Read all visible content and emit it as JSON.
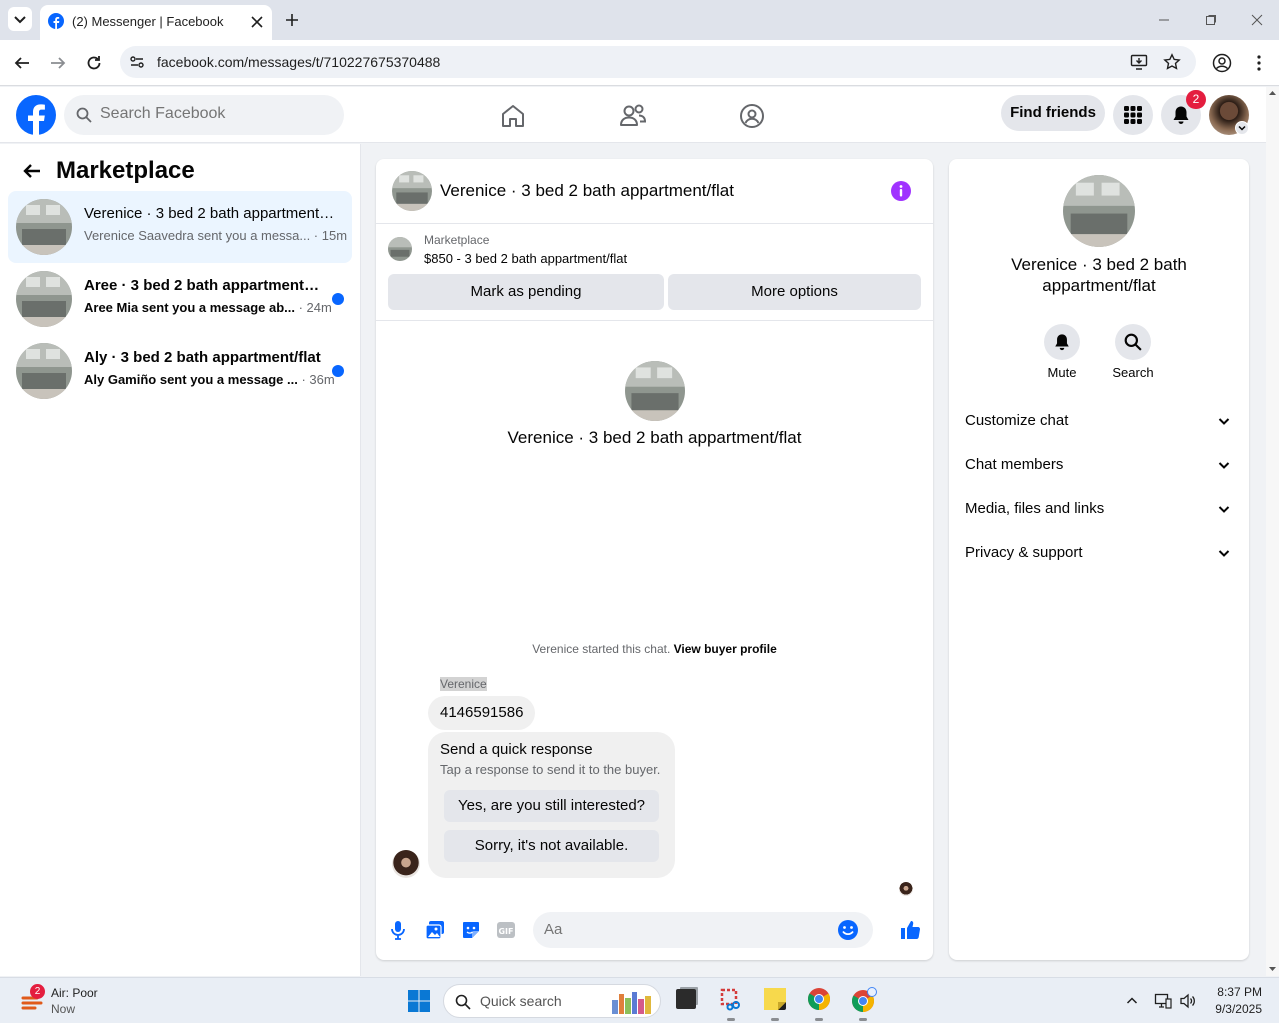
{
  "browser": {
    "tab_title": "(2) Messenger | Facebook",
    "url": "facebook.com/messages/t/710227675370488"
  },
  "header": {
    "search_placeholder": "Search Facebook",
    "find_friends": "Find friends",
    "notification_count": "2"
  },
  "sidebar": {
    "title": "Marketplace",
    "conversations": [
      {
        "title": "Verenice · 3 bed 2 bath appartment/flat",
        "preview": "Verenice Saavedra sent you a messa...",
        "time": "15m",
        "unread": false
      },
      {
        "title": "Aree · 3 bed 2 bath appartment/flat",
        "preview": "Aree Mia sent you a message ab...",
        "time": "24m",
        "unread": true
      },
      {
        "title": "Aly · 3 bed 2 bath appartment/flat",
        "preview": "Aly Gamiño sent you a message ...",
        "time": "36m",
        "unread": true
      }
    ]
  },
  "chat": {
    "title": "Verenice · 3 bed 2 bath appartment/flat",
    "listing_source": "Marketplace",
    "listing_summary": "$850 - 3 bed 2 bath appartment/flat",
    "mark_pending": "Mark as pending",
    "more_options": "More options",
    "intro_title": "Verenice · 3 bed 2 bath appartment/flat",
    "started_text": "Verenice started this chat.",
    "view_profile": "View buyer profile",
    "sender_name": "Verenice",
    "message": "4146591586",
    "quick_title": "Send a quick response",
    "quick_sub": "Tap a response to send it to the buyer.",
    "quick_options": [
      "Yes, are you still interested?",
      "Sorry, it's not available."
    ],
    "composer_placeholder": "Aa"
  },
  "details": {
    "title": "Verenice · 3 bed 2 bath appartment/flat",
    "mute": "Mute",
    "search": "Search",
    "sections": [
      "Customize chat",
      "Chat members",
      "Media, files and links",
      "Privacy & support"
    ]
  },
  "taskbar": {
    "weather_title": "Air: Poor",
    "weather_sub": "Now",
    "weather_badge": "2",
    "search_placeholder": "Quick search",
    "time": "8:37 PM",
    "date": "9/3/2025"
  },
  "colors": {
    "fb_blue": "#0866ff",
    "info_purple": "#a033ff",
    "badge_red": "#e41e3f"
  }
}
